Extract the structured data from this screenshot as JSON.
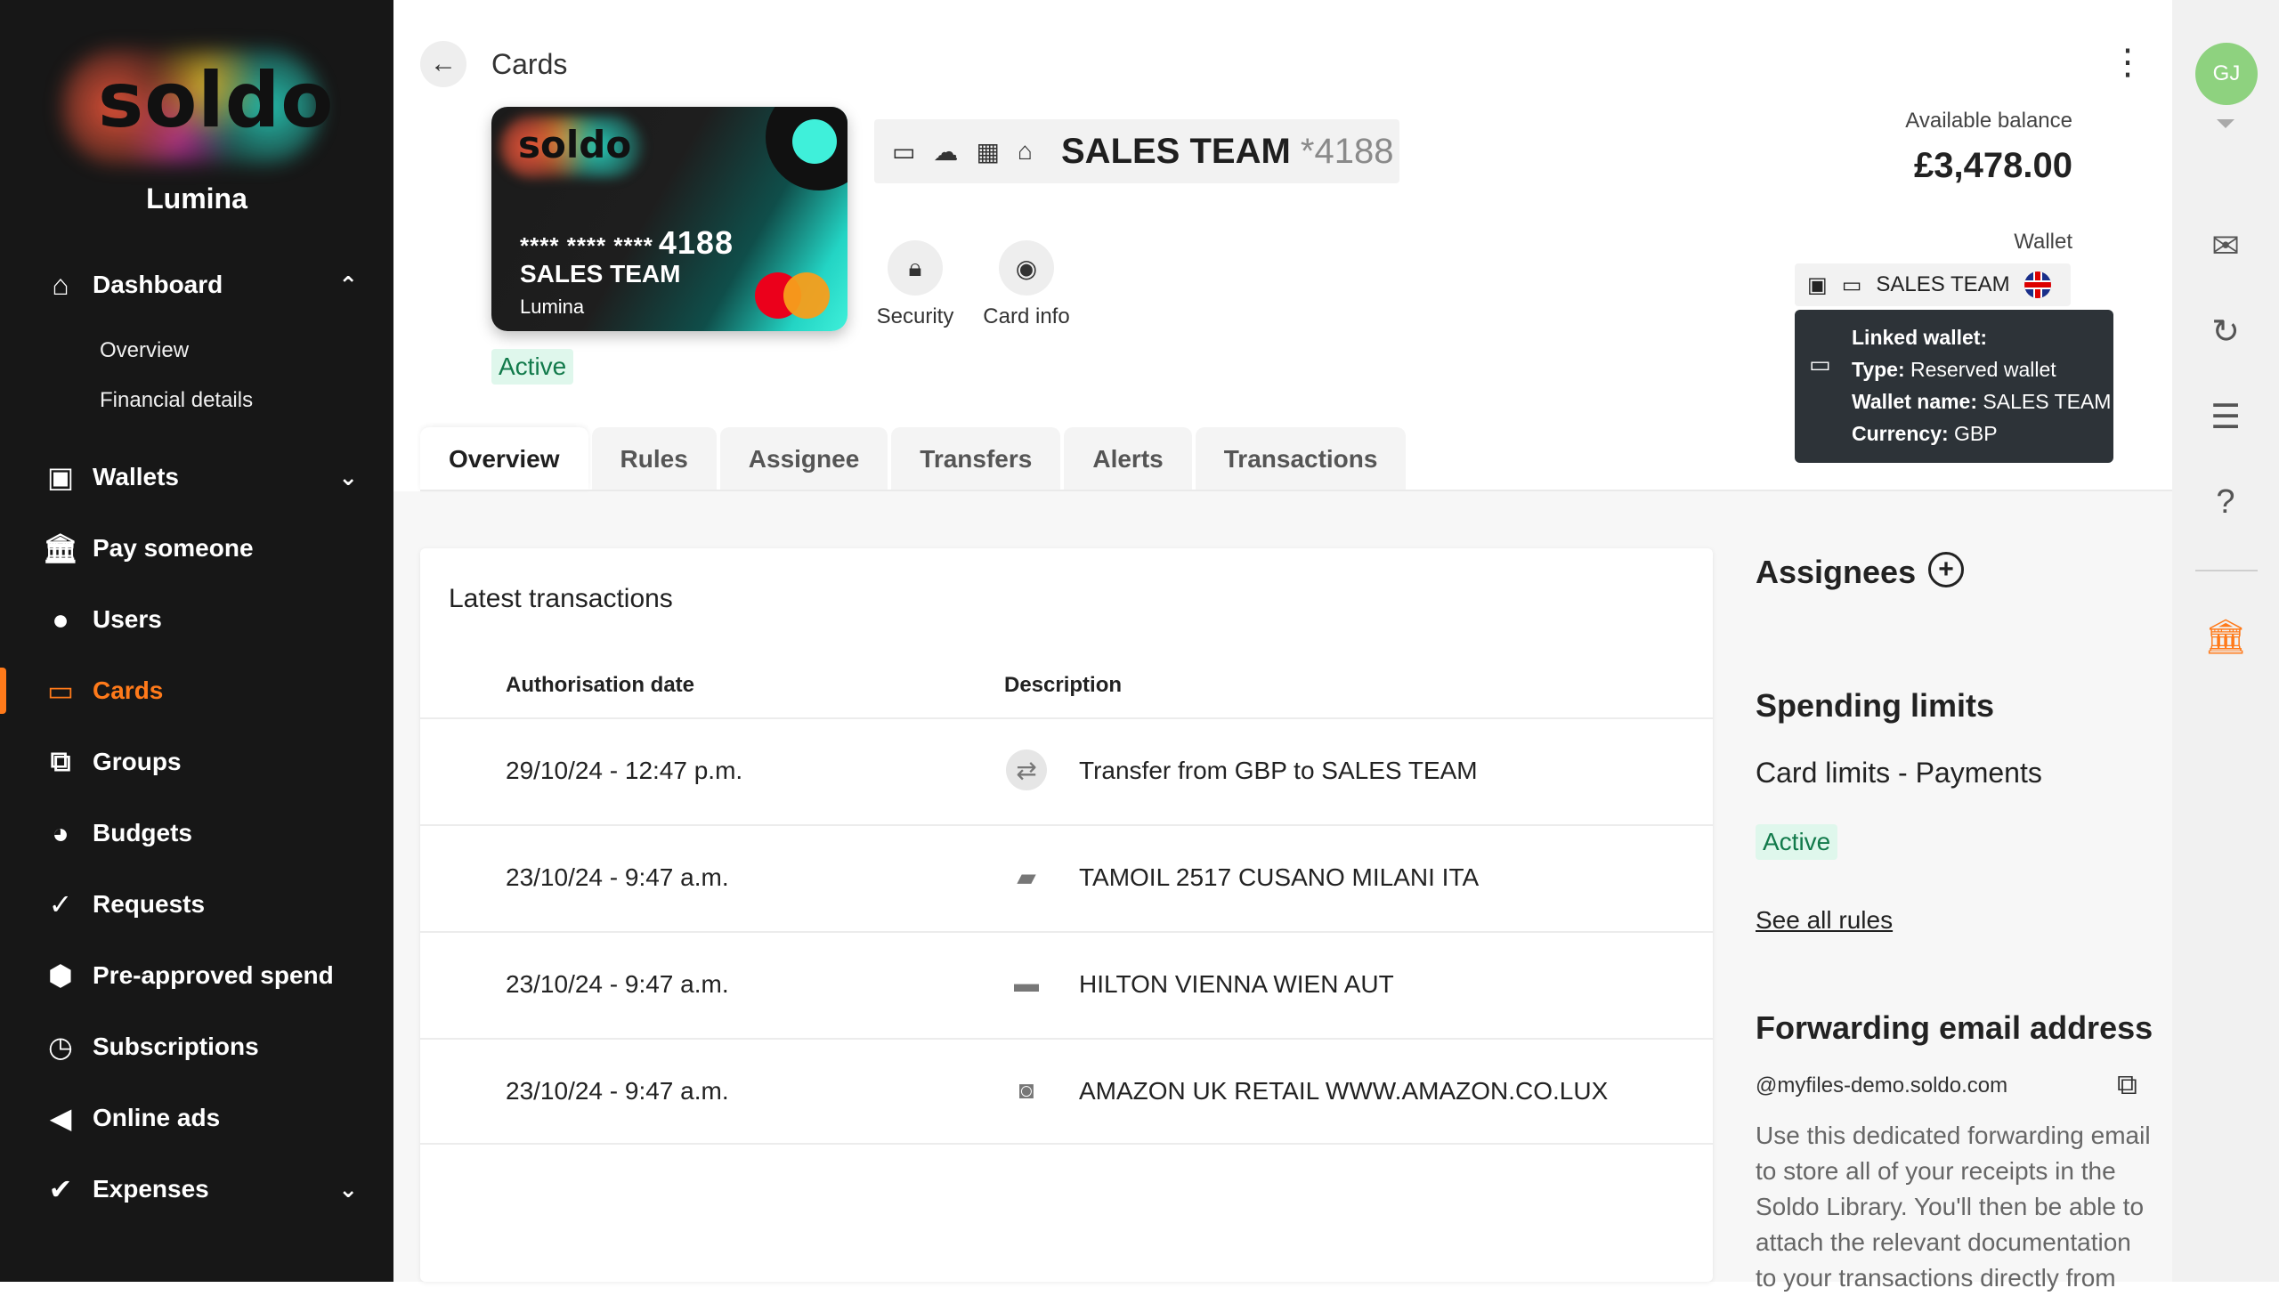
{
  "sidebar": {
    "logo": "soldo",
    "org_name": "Lumina",
    "items": [
      {
        "label": "Dashboard",
        "icon": "home-icon"
      },
      {
        "label": "Wallets",
        "icon": "wallet-icon"
      },
      {
        "label": "Pay someone",
        "icon": "bank-icon"
      },
      {
        "label": "Users",
        "icon": "user-icon"
      },
      {
        "label": "Cards",
        "icon": "card-icon"
      },
      {
        "label": "Groups",
        "icon": "groups-icon"
      },
      {
        "label": "Budgets",
        "icon": "pie-chart-icon"
      },
      {
        "label": "Requests",
        "icon": "double-check-icon"
      },
      {
        "label": "Pre-approved spend",
        "icon": "hexagon-icon"
      },
      {
        "label": "Subscriptions",
        "icon": "clock-icon"
      },
      {
        "label": "Online ads",
        "icon": "megaphone-icon"
      },
      {
        "label": "Expenses",
        "icon": "check-icon"
      }
    ],
    "dashboard_sub": [
      "Overview",
      "Financial details"
    ],
    "accent_color": "#ff7a1a"
  },
  "header": {
    "title": "Cards"
  },
  "card": {
    "logo": "soldo",
    "masked": "**** **** ****",
    "last4": "4188",
    "name": "SALES TEAM",
    "org": "Lumina",
    "status": "Active",
    "title": "SALES TEAM",
    "title_suffix": "*4188"
  },
  "actions": {
    "security": "Security",
    "card_info": "Card info"
  },
  "balance": {
    "label": "Available balance",
    "value": "£3,478.00",
    "wallet_label": "Wallet",
    "wallet_name": "SALES TEAM"
  },
  "tooltip": {
    "title": "Linked wallet:",
    "type_label": "Type:",
    "type_value": "Reserved wallet",
    "name_label": "Wallet name:",
    "name_value": "SALES TEAM",
    "currency_label": "Currency:",
    "currency_value": "GBP"
  },
  "tabs": [
    "Overview",
    "Rules",
    "Assignee",
    "Transfers",
    "Alerts",
    "Transactions"
  ],
  "transactions": {
    "title": "Latest transactions",
    "col_date": "Authorisation date",
    "col_desc": "Description",
    "rows": [
      {
        "date": "29/10/24 - 12:47 p.m.",
        "desc": "Transfer from GBP to SALES TEAM",
        "icon": "transfer-icon"
      },
      {
        "date": "23/10/24 - 9:47 a.m.",
        "desc": "TAMOIL 2517 CUSANO MILANI ITA",
        "icon": "car-icon"
      },
      {
        "date": "23/10/24 - 9:47 a.m.",
        "desc": "HILTON VIENNA WIEN AUT",
        "icon": "bed-icon"
      },
      {
        "date": "23/10/24 - 9:47 a.m.",
        "desc": "AMAZON UK RETAIL WWW.AMAZON.CO.LUX",
        "icon": "shopping-bag-icon"
      }
    ]
  },
  "right_panel": {
    "assignees": "Assignees",
    "spending_limits": "Spending limits",
    "card_limits": "Card limits - Payments",
    "limit_status": "Active",
    "see_all": "See all rules",
    "forwarding_title": "Forwarding email address",
    "email": "@myfiles-demo.soldo.com",
    "description": "Use this dedicated forwarding email to store all of your receipts in the Soldo Library. You'll then be able to attach the relevant documentation to your transactions directly from"
  },
  "user": {
    "initials": "GJ"
  }
}
